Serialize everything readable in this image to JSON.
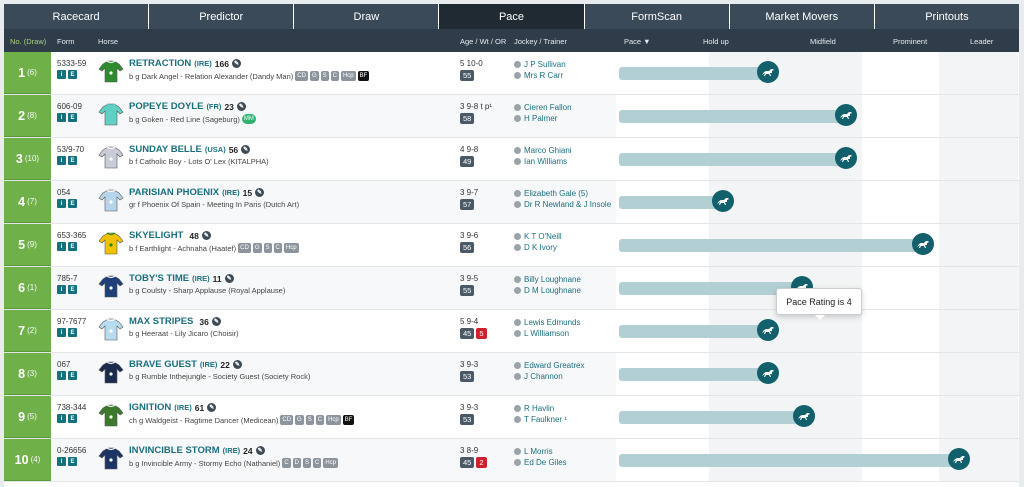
{
  "tabs": [
    {
      "label": "Racecard",
      "active": false
    },
    {
      "label": "Predictor",
      "active": false
    },
    {
      "label": "Draw",
      "active": false
    },
    {
      "label": "Pace",
      "active": true
    },
    {
      "label": "FormScan",
      "active": false
    },
    {
      "label": "Market Movers",
      "active": false
    },
    {
      "label": "Printouts",
      "active": false
    }
  ],
  "columns": {
    "draw": "No. (Draw)",
    "form": "Form",
    "horse": "Horse",
    "awo": "Age / Wt / OR",
    "jt": "Jockey / Trainer",
    "pace": "Pace ▼",
    "holdup": "Hold up",
    "midfield": "Midfield",
    "prominent": "Prominent",
    "leader": "Leader"
  },
  "runners": [
    {
      "no": "1",
      "draw": "(6)",
      "form": "5333-59",
      "name": "RETRACTION",
      "country": "(IRE)",
      "rating": "166",
      "breeding": "b g Dark Angel - Relation Alexander (Dandy Man)",
      "tags": [
        "CD",
        "G",
        "S",
        "C",
        "Hcp",
        "BF"
      ],
      "age_wt": "5 10-0",
      "or": "55",
      "or_extra": "",
      "jockey": "J P Sullivan",
      "trainer": "Mrs R Carr",
      "pace": 2
    },
    {
      "no": "2",
      "draw": "(8)",
      "form": "606-09",
      "name": "POPEYE DOYLE",
      "country": "(FR)",
      "rating": "23",
      "breeding": "b g Goken - Red Line (Sageburg)",
      "tags": [
        "MM"
      ],
      "age_wt": "3 9-8 t p¹",
      "or": "58",
      "or_extra": "",
      "jockey": "Cieren Fallon",
      "trainer": "H Palmer",
      "pace": 3
    },
    {
      "no": "3",
      "draw": "(10)",
      "form": "53/9-70",
      "name": "SUNDAY BELLE",
      "country": "(USA)",
      "rating": "56",
      "breeding": "b f Catholic Boy - Lots O' Lex (KITALPHA)",
      "tags": [],
      "age_wt": "4 9-8",
      "or": "49",
      "or_extra": "",
      "jockey": "Marco Ghiani",
      "trainer": "Ian Williams",
      "pace": 3
    },
    {
      "no": "4",
      "draw": "(7)",
      "form": "054",
      "name": "PARISIAN PHOENIX",
      "country": "(IRE)",
      "rating": "15",
      "breeding": "gr f Phoenix Of Spain - Meeting In Paris (Dutch Art)",
      "tags": [],
      "age_wt": "3 9-7",
      "or": "57",
      "or_extra": "",
      "jockey": "Elizabeth Gale (5)",
      "trainer": "Dr R Newland & J Insole",
      "pace": 1
    },
    {
      "no": "5",
      "draw": "(9)",
      "form": "653-365",
      "name": "SKYELIGHT",
      "country": "",
      "rating": "48",
      "breeding": "b f Earthlight - Achnaha (Haatef)",
      "tags": [
        "CD",
        "G",
        "S",
        "C",
        "Hcp"
      ],
      "age_wt": "3 9-6",
      "or": "56",
      "or_extra": "",
      "jockey": "K T O'Neill",
      "trainer": "D K Ivory",
      "pace": 4
    },
    {
      "no": "6",
      "draw": "(1)",
      "form": "785-7",
      "name": "TOBY'S TIME",
      "country": "(IRE)",
      "rating": "11",
      "breeding": "b g Coulsty - Sharp Applause (Royal Applause)",
      "tags": [],
      "age_wt": "3 9-5",
      "or": "55",
      "or_extra": "",
      "jockey": "Billy Loughnane",
      "trainer": "D M Loughnane",
      "pace": 4
    },
    {
      "no": "7",
      "draw": "(2)",
      "form": "97-7677",
      "name": "MAX STRIPES",
      "country": "",
      "rating": "36",
      "breeding": "b g Heeraat - Lily Jicaro (Choisir)",
      "tags": [],
      "age_wt": "5 9-4",
      "or": "45",
      "or_extra": "5",
      "jockey": "Lewis Edmunds",
      "trainer": "L Williamson",
      "pace": 2
    },
    {
      "no": "8",
      "draw": "(3)",
      "form": "067",
      "name": "BRAVE GUEST",
      "country": "(IRE)",
      "rating": "22",
      "breeding": "b g Rumble Inthejungle - Society Guest (Society Rock)",
      "tags": [],
      "age_wt": "3 9-3",
      "or": "53",
      "or_extra": "",
      "jockey": "Edward Greatrex",
      "trainer": "J Channon",
      "pace": 2
    },
    {
      "no": "9",
      "draw": "(5)",
      "form": "738-344",
      "name": "IGNITION",
      "country": "(IRE)",
      "rating": "61",
      "breeding": "ch g Waldgeist - Ragtime Dancer (Medicean)",
      "tags": [
        "CD",
        "G",
        "S",
        "C",
        "Hcp",
        "BF"
      ],
      "age_wt": "3 9-3",
      "or": "53",
      "or_extra": "",
      "jockey": "R Havlin",
      "trainer": "T Faulkner ¹",
      "pace": 3
    },
    {
      "no": "10",
      "draw": "(4)",
      "form": "0-26656",
      "name": "INVINCIBLE STORM",
      "country": "(IRE)",
      "rating": "24",
      "breeding": "b g Invincible Army - Stormy Echo (Nathaniel)",
      "tags": [
        "C",
        "D",
        "S",
        "C",
        "Hcp"
      ],
      "age_wt": "3 8-9",
      "or": "45",
      "or_extra": "2",
      "jockey": "L Morris",
      "trainer": "Ed De Giles",
      "pace": 5
    }
  ],
  "tooltip": "Pace Rating is 4",
  "colors": {
    "green": "#6fb049",
    "teal": "#12606b",
    "track": "#b2d0d4",
    "tab_bg": "#3a4a58",
    "tab_active": "#1f2a33"
  }
}
